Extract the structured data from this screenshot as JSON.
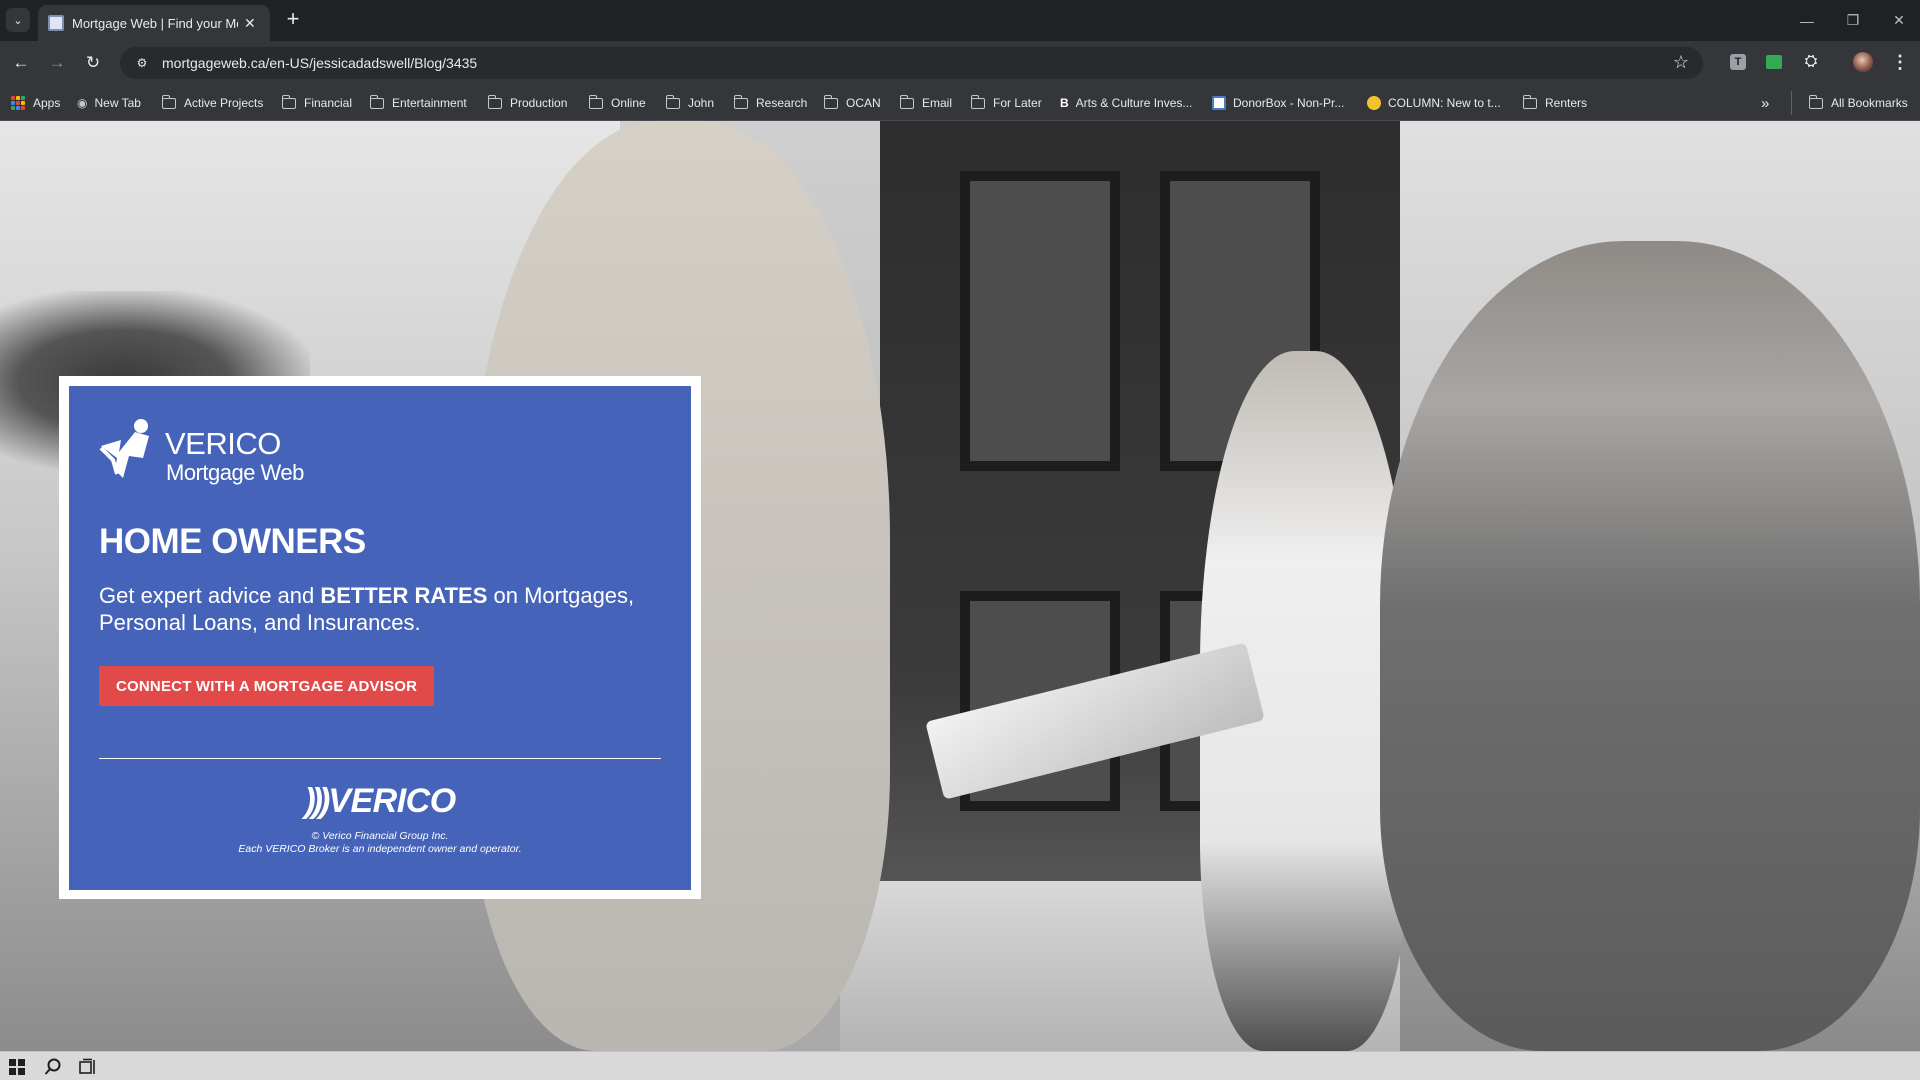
{
  "browser": {
    "tab_title": "Mortgage Web | Find your Mor",
    "url": "mortgageweb.ca/en-US/jessicadadswell/Blog/3435",
    "bookmarks": [
      {
        "label": "Apps",
        "icon": "apps-grid-icon"
      },
      {
        "label": "New Tab",
        "icon": "globe-icon"
      },
      {
        "label": "Active Projects",
        "icon": "folder-icon"
      },
      {
        "label": "Financial",
        "icon": "folder-icon"
      },
      {
        "label": "Entertainment",
        "icon": "folder-icon"
      },
      {
        "label": "Production",
        "icon": "folder-icon"
      },
      {
        "label": "Online",
        "icon": "folder-icon"
      },
      {
        "label": "John",
        "icon": "folder-icon"
      },
      {
        "label": "Research",
        "icon": "folder-icon"
      },
      {
        "label": "OCAN",
        "icon": "folder-icon"
      },
      {
        "label": "Email",
        "icon": "folder-icon"
      },
      {
        "label": "For Later",
        "icon": "folder-icon"
      },
      {
        "label": "Arts & Culture Inves...",
        "icon": "b-favicon-icon"
      },
      {
        "label": "DonorBox - Non-Pr...",
        "icon": "donorbox-icon"
      },
      {
        "label": "COLUMN: New to t...",
        "icon": "column-favicon-icon"
      },
      {
        "label": "Renters",
        "icon": "folder-icon"
      }
    ],
    "overflow_label": "»",
    "all_bookmarks_label": "All Bookmarks"
  },
  "promo": {
    "logo_line1": "VERICO",
    "logo_line2": "Mortgage Web",
    "headline": "HOME OWNERS",
    "subtext_part1": "Get expert advice and ",
    "subtext_bold": "BETTER RATES",
    "subtext_part2": " on Mortgages, Personal Loans, and Insurances.",
    "cta_label": "CONNECT WITH A MORTGAGE ADVISOR",
    "footer_logo_text": "VERICO",
    "copyright_line1": "© Verico Financial Group Inc.",
    "copyright_line2": "Each VERICO Broker is an independent owner and operator.",
    "colors": {
      "card_bg": "#4564b9",
      "cta_bg": "#e24a4a"
    }
  }
}
